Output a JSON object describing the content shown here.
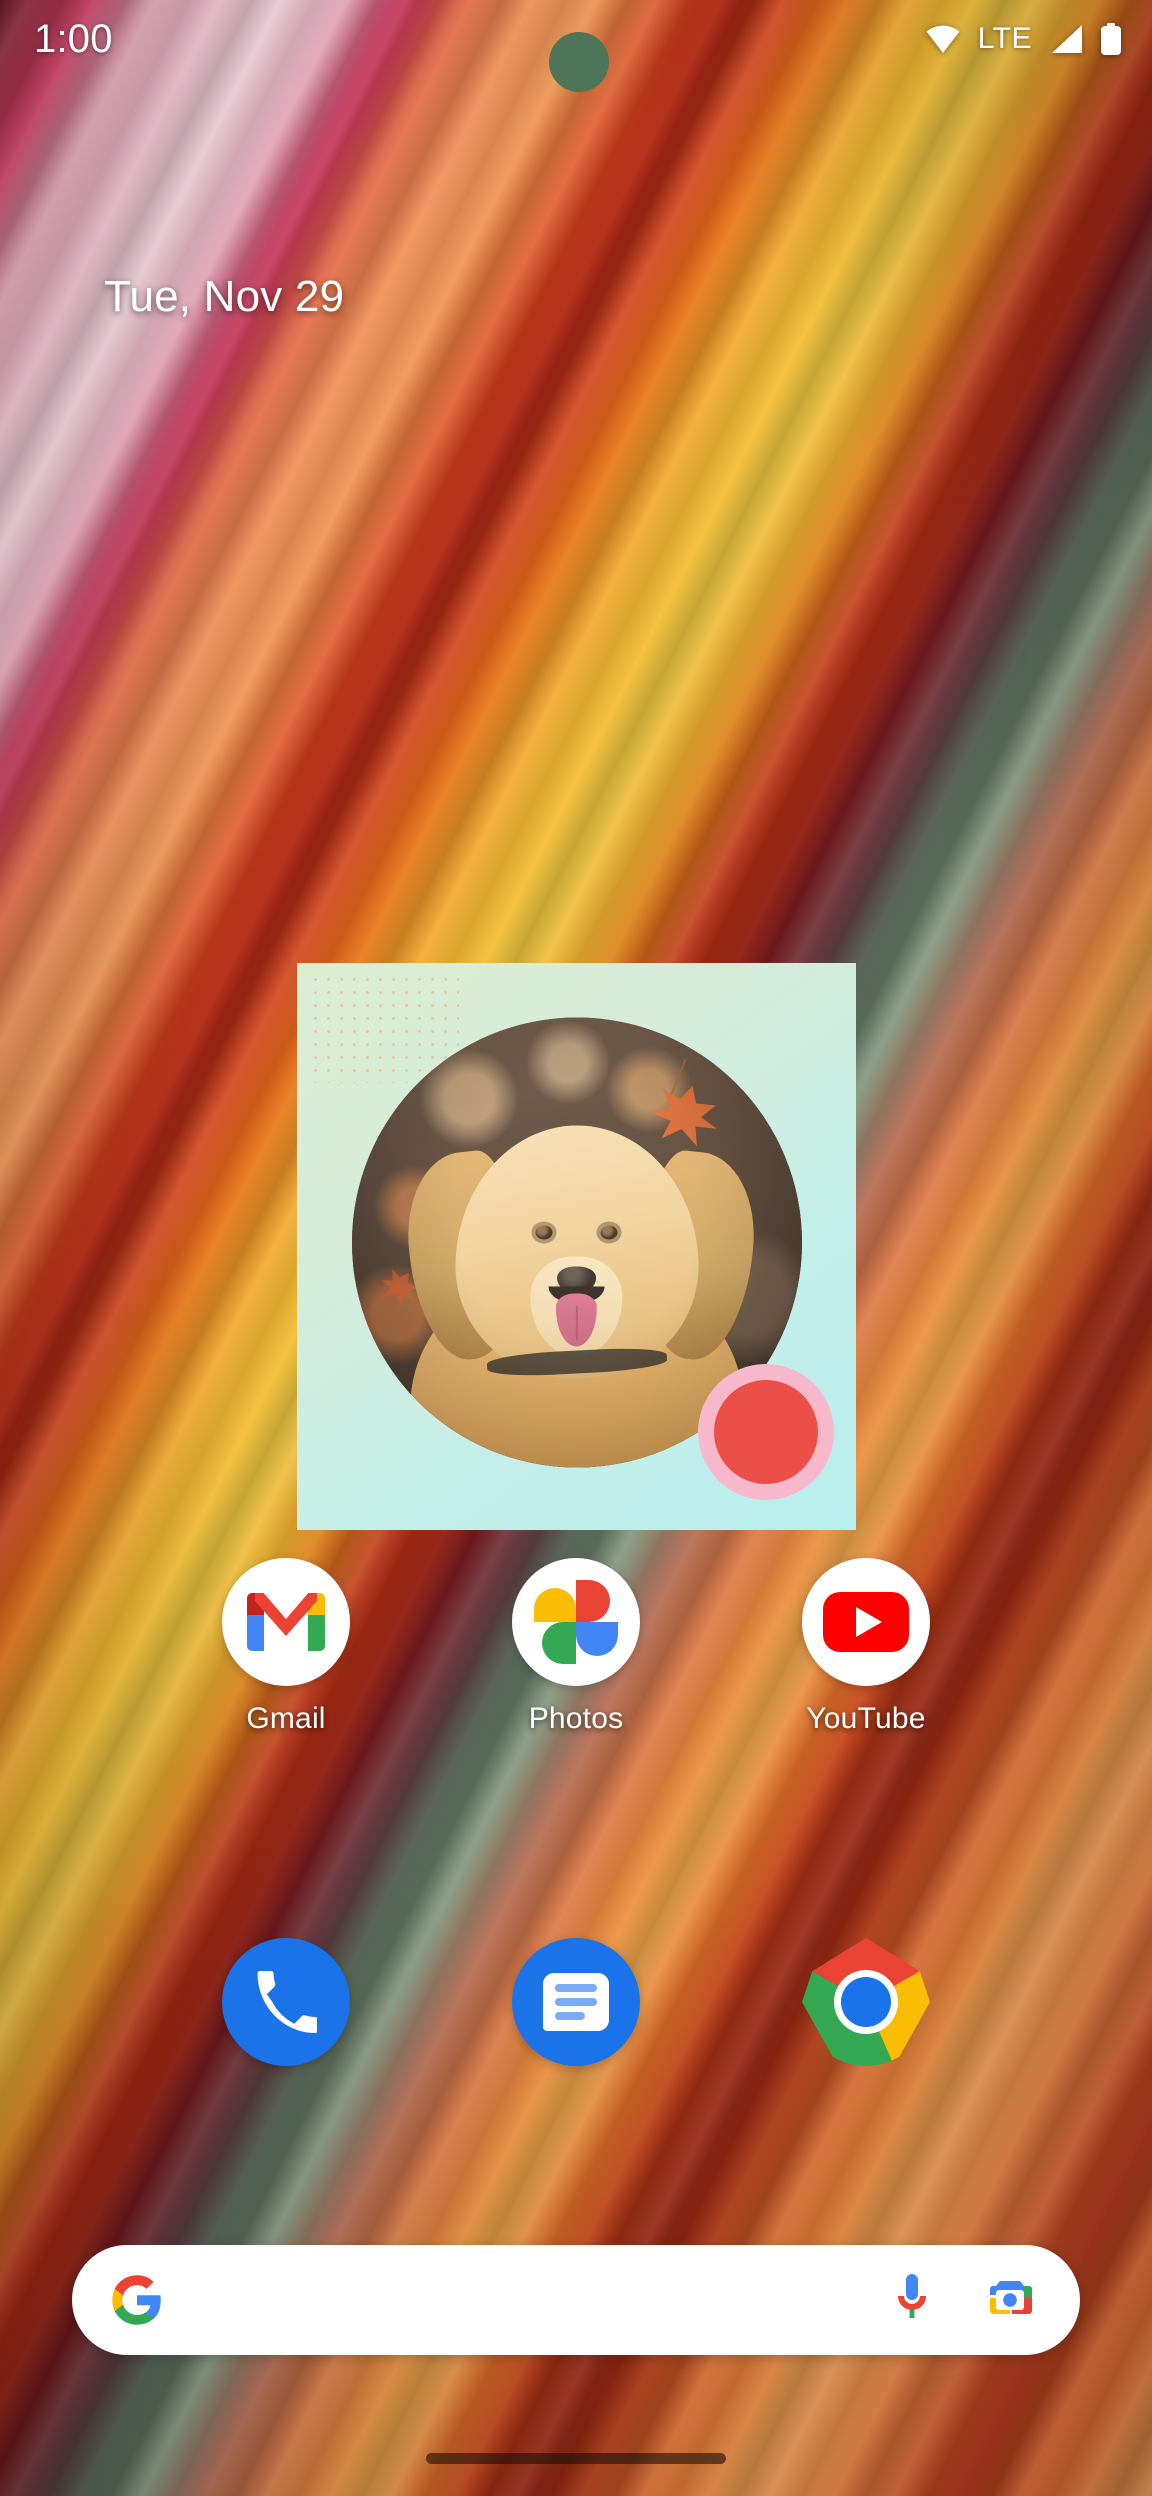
{
  "status_bar": {
    "time": "1:00",
    "network_label": "LTE",
    "icons": [
      "wifi-icon",
      "signal-icon",
      "battery-icon"
    ]
  },
  "date_widget": {
    "text": "Tue, Nov 29"
  },
  "photo_widget": {
    "name": "photo-frame-widget",
    "subject": "golden retriever dog with tongue out among autumn leaves",
    "background_color": "#d6ecd9",
    "badge_color": "#ec4f48",
    "badge_ring_color": "#f7b8cc"
  },
  "apps": [
    {
      "label": "Gmail",
      "icon": "gmail-icon"
    },
    {
      "label": "Photos",
      "icon": "google-photos-icon"
    },
    {
      "label": "YouTube",
      "icon": "youtube-icon"
    }
  ],
  "dock": [
    {
      "label": "Phone",
      "icon": "phone-icon"
    },
    {
      "label": "Messages",
      "icon": "messages-icon"
    },
    {
      "label": "Chrome",
      "icon": "chrome-icon"
    }
  ],
  "search": {
    "value": "",
    "placeholder": "",
    "logo": "google-g-icon",
    "mic": "microphone-icon",
    "lens": "google-lens-icon"
  },
  "navigation": {
    "gesture_pill": "home-gesture-pill"
  },
  "theme": {
    "accent_red": "#ea4335",
    "accent_blue": "#4285f4",
    "accent_green": "#34a853",
    "accent_yellow": "#fbbc04",
    "text_on_wallpaper": "#ffffff"
  }
}
